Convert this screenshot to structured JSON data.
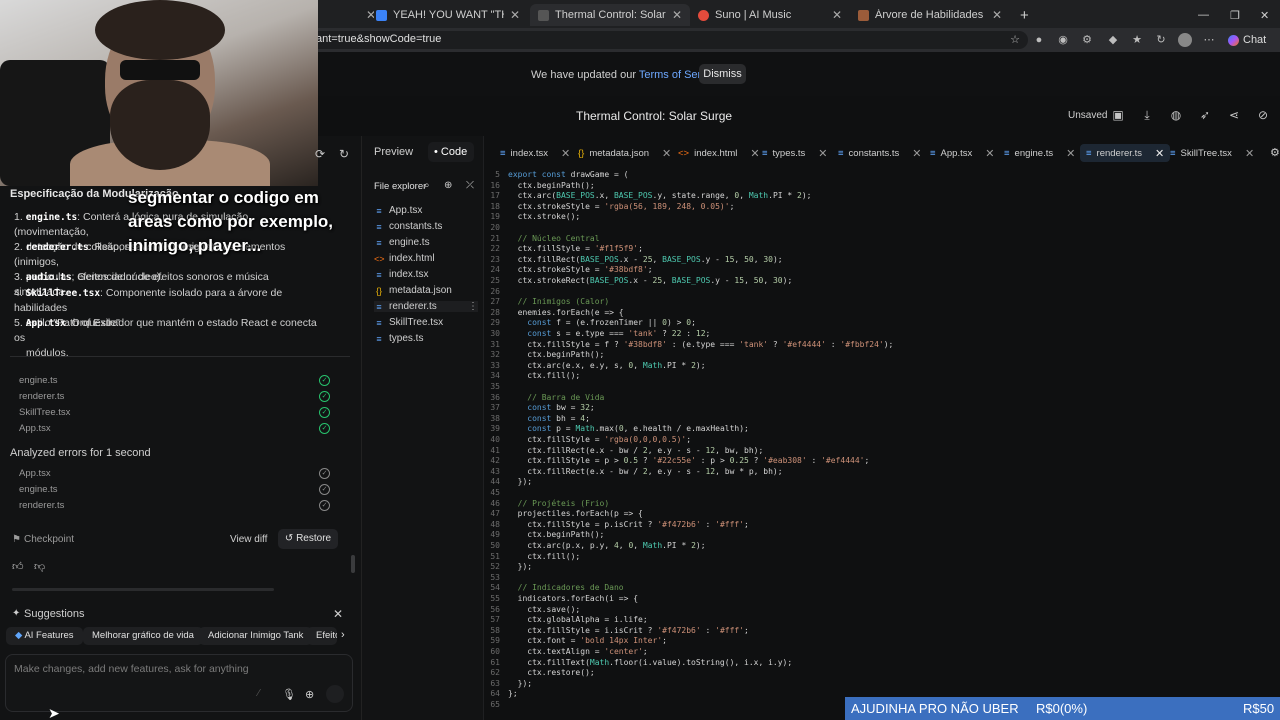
{
  "browser": {
    "tabs": [
      {
        "label": "YEAH! YOU WANT \"THOSE GAMES\"",
        "active": false
      },
      {
        "label": "Thermal Control: Solar Surge | Go",
        "active": true
      },
      {
        "label": "Suno | AI Music",
        "active": false
      },
      {
        "label": "Árvore de Habilidades Passivas - C",
        "active": false
      }
    ],
    "url": "ant=true&showCode=true",
    "chat_label": "Chat"
  },
  "banner": {
    "text_before": "We have updated our",
    "link": "Terms of Service",
    "dismiss": "Dismiss"
  },
  "header": {
    "title": "Thermal Control: Solar Surge",
    "unsaved": "Unsaved"
  },
  "overlay_caption": {
    "line1": "segmentar o codigo em",
    "line2": "areas como por exemplo,",
    "line3": "inimigo, player..."
  },
  "chat": {
    "heading": "Especificação da Modularização",
    "items": [
      {
        "num": "1.",
        "code": "engine.ts",
        "text": ": Conterá a lógica pura de simulação (movimentação,",
        "text2": "detecção de colisão, spawn de inimigos)."
      },
      {
        "num": "2.",
        "code": "renderer.ts",
        "text": ": Responsável por desenhar os elementos (inimigos,",
        "text2": "partículas, efeitos de núcleo)."
      },
      {
        "num": "3.",
        "code": "audio.ts",
        "text": ": Gerenciador de efeitos sonoros e música sintetizada.",
        "text2": ""
      },
      {
        "num": "4.",
        "code": "SkillTree.tsx",
        "text": ": Componente isolado para a árvore de habilidades",
        "text2": "estilo \"Path of Exile\"."
      },
      {
        "num": "5.",
        "code": "App.tsx",
        "text": ": Orquestrador que mantém o estado React e conecta os",
        "text2": "módulos."
      }
    ],
    "done_files": [
      "engine.ts",
      "renderer.ts",
      "SkillTree.tsx",
      "App.tsx"
    ],
    "analyzed": "Analyzed errors for 1 second",
    "analyzed_files": [
      "App.tsx",
      "engine.ts",
      "renderer.ts"
    ],
    "checkpoint": "Checkpoint",
    "view_diff": "View diff",
    "restore": "Restore",
    "suggestions": "Suggestions",
    "chips": [
      "AI Features",
      "Melhorar gráfico de vida",
      "Adicionar Inimigo Tank",
      "Efeito"
    ],
    "prompt_placeholder": "Make changes, add new features, ask for anything"
  },
  "panel_tabs": {
    "preview": "Preview",
    "code": "Code"
  },
  "explorer": {
    "title": "File explorer",
    "files": [
      {
        "name": "App.tsx",
        "icon": "ts-file-icon"
      },
      {
        "name": "constants.ts",
        "icon": "ts-file-icon"
      },
      {
        "name": "engine.ts",
        "icon": "ts-file-icon"
      },
      {
        "name": "index.html",
        "icon": "html-file-icon"
      },
      {
        "name": "index.tsx",
        "icon": "ts-file-icon"
      },
      {
        "name": "metadata.json",
        "icon": "json-file-icon"
      },
      {
        "name": "renderer.ts",
        "icon": "ts-file-icon",
        "selected": true
      },
      {
        "name": "SkillTree.tsx",
        "icon": "ts-file-icon"
      },
      {
        "name": "types.ts",
        "icon": "ts-file-icon"
      }
    ]
  },
  "editor_tabs": [
    "index.tsx",
    "metadata.json",
    "index.html",
    "types.ts",
    "constants.ts",
    "App.tsx",
    "engine.ts",
    "renderer.ts",
    "SkillTree.tsx"
  ],
  "active_editor_tab": "renderer.ts",
  "code_lines": [
    {
      "n": "5",
      "t": "export const drawGame = ("
    },
    {
      "n": "16",
      "t": "  ctx.beginPath();"
    },
    {
      "n": "17",
      "t": "  ctx.arc(BASE_POS.x, BASE_POS.y, state.range, 0, Math.PI * 2);"
    },
    {
      "n": "18",
      "t": "  ctx.strokeStyle = 'rgba(56, 189, 248, 0.05)';"
    },
    {
      "n": "19",
      "t": "  ctx.stroke();"
    },
    {
      "n": "20",
      "t": ""
    },
    {
      "n": "21",
      "t": "  // Núcleo Central"
    },
    {
      "n": "22",
      "t": "  ctx.fillStyle = '#f1f5f9';"
    },
    {
      "n": "23",
      "t": "  ctx.fillRect(BASE_POS.x - 25, BASE_POS.y - 15, 50, 30);"
    },
    {
      "n": "24",
      "t": "  ctx.strokeStyle = '#38bdf8';"
    },
    {
      "n": "25",
      "t": "  ctx.strokeRect(BASE_POS.x - 25, BASE_POS.y - 15, 50, 30);"
    },
    {
      "n": "26",
      "t": ""
    },
    {
      "n": "27",
      "t": "  // Inimigos (Calor)"
    },
    {
      "n": "28",
      "t": "  enemies.forEach(e => {"
    },
    {
      "n": "29",
      "t": "    const f = (e.frozenTimer || 0) > 0;"
    },
    {
      "n": "30",
      "t": "    const s = e.type === 'tank' ? 22 : 12;"
    },
    {
      "n": "31",
      "t": "    ctx.fillStyle = f ? '#38bdf8' : (e.type === 'tank' ? '#ef4444' : '#fbbf24');"
    },
    {
      "n": "32",
      "t": "    ctx.beginPath();"
    },
    {
      "n": "33",
      "t": "    ctx.arc(e.x, e.y, s, 0, Math.PI * 2);"
    },
    {
      "n": "34",
      "t": "    ctx.fill();"
    },
    {
      "n": "35",
      "t": ""
    },
    {
      "n": "36",
      "t": "    // Barra de Vida"
    },
    {
      "n": "37",
      "t": "    const bw = 32;"
    },
    {
      "n": "38",
      "t": "    const bh = 4;"
    },
    {
      "n": "39",
      "t": "    const p = Math.max(0, e.health / e.maxHealth);"
    },
    {
      "n": "40",
      "t": "    ctx.fillStyle = 'rgba(0,0,0,0.5)';"
    },
    {
      "n": "41",
      "t": "    ctx.fillRect(e.x - bw / 2, e.y - s - 12, bw, bh);"
    },
    {
      "n": "42",
      "t": "    ctx.fillStyle = p > 0.5 ? '#22c55e' : p > 0.25 ? '#eab308' : '#ef4444';"
    },
    {
      "n": "43",
      "t": "    ctx.fillRect(e.x - bw / 2, e.y - s - 12, bw * p, bh);"
    },
    {
      "n": "44",
      "t": "  });"
    },
    {
      "n": "45",
      "t": ""
    },
    {
      "n": "46",
      "t": "  // Projéteis (Frio)"
    },
    {
      "n": "47",
      "t": "  projectiles.forEach(p => {"
    },
    {
      "n": "48",
      "t": "    ctx.fillStyle = p.isCrit ? '#f472b6' : '#fff';"
    },
    {
      "n": "49",
      "t": "    ctx.beginPath();"
    },
    {
      "n": "50",
      "t": "    ctx.arc(p.x, p.y, 4, 0, Math.PI * 2);"
    },
    {
      "n": "51",
      "t": "    ctx.fill();"
    },
    {
      "n": "52",
      "t": "  });"
    },
    {
      "n": "53",
      "t": ""
    },
    {
      "n": "54",
      "t": "  // Indicadores de Dano"
    },
    {
      "n": "55",
      "t": "  indicators.forEach(i => {"
    },
    {
      "n": "56",
      "t": "    ctx.save();"
    },
    {
      "n": "57",
      "t": "    ctx.globalAlpha = i.life;"
    },
    {
      "n": "58",
      "t": "    ctx.fillStyle = i.isCrit ? '#f472b6' : '#fff';"
    },
    {
      "n": "59",
      "t": "    ctx.font = 'bold 14px Inter';"
    },
    {
      "n": "60",
      "t": "    ctx.textAlign = 'center';"
    },
    {
      "n": "61",
      "t": "    ctx.fillText(Math.floor(i.value).toString(), i.x, i.y);"
    },
    {
      "n": "62",
      "t": "    ctx.restore();"
    },
    {
      "n": "63",
      "t": "  });"
    },
    {
      "n": "64",
      "t": "};"
    },
    {
      "n": "65",
      "t": ""
    }
  ],
  "donation": {
    "label": "AJUDINHA PRO NÃO UBER",
    "amount": "R$0(0%)",
    "goal": "R$50"
  },
  "colors": {
    "accent": "#6ea8fe",
    "check": "#27c26c",
    "donation_bar": "#3b6fbf"
  }
}
